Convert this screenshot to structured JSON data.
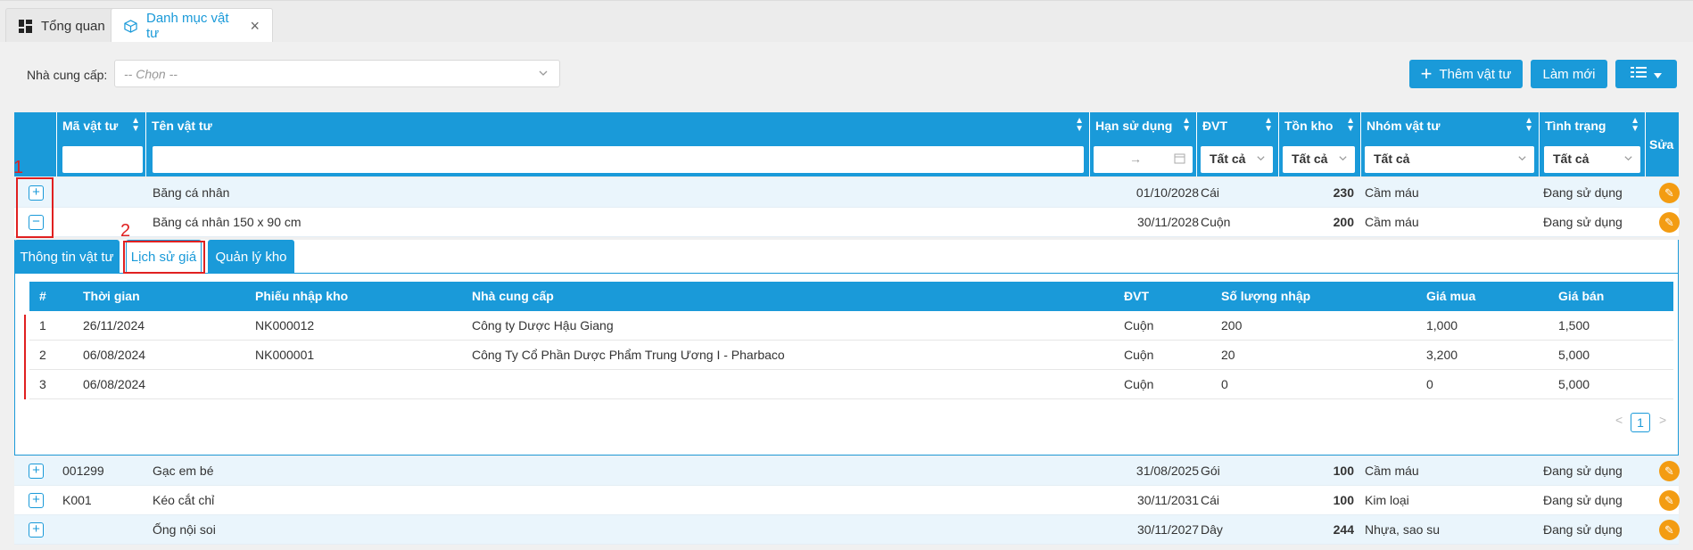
{
  "tabs": [
    {
      "label": "Tổng quan",
      "icon": "dashboard-icon"
    },
    {
      "label": "Danh mục vật tư",
      "icon": "box-icon",
      "active": true
    }
  ],
  "filter": {
    "supplier_label": "Nhà cung cấp:",
    "supplier_placeholder": "-- Chọn --"
  },
  "toolbar": {
    "add_label": "Thêm vật tư",
    "refresh_label": "Làm mới"
  },
  "columns": {
    "code": "Mã vật tư",
    "name": "Tên vật tư",
    "expiry": "Hạn sử dụng",
    "unit": "ĐVT",
    "stock": "Tồn kho",
    "group": "Nhóm vật tư",
    "status": "Tình trạng",
    "edit": "Sửa"
  },
  "column_filters": {
    "date_arrow": "→",
    "unit": "Tất cả",
    "stock": "Tất cả",
    "group": "Tất cả",
    "status": "Tất cả"
  },
  "rows": [
    {
      "code": "",
      "name": "Băng cá nhân",
      "expiry": "01/10/2028",
      "unit": "Cái",
      "stock": "230",
      "group": "Cầm máu",
      "status": "Đang sử dụng",
      "expanded": false
    },
    {
      "code": "",
      "name": "Băng cá nhân 150 x 90 cm",
      "expiry": "30/11/2028",
      "unit": "Cuộn",
      "stock": "200",
      "group": "Cầm máu",
      "status": "Đang sử dụng",
      "expanded": true
    },
    {
      "code": "001299",
      "name": "Gạc em bé",
      "expiry": "31/08/2025",
      "unit": "Gói",
      "stock": "100",
      "group": "Cầm máu",
      "status": "Đang sử dụng",
      "expanded": false
    },
    {
      "code": "K001",
      "name": "Kéo cắt chỉ",
      "expiry": "30/11/2031",
      "unit": "Cái",
      "stock": "100",
      "group": "Kim loại",
      "status": "Đang sử dụng",
      "expanded": false
    },
    {
      "code": "",
      "name": "Ống nội soi",
      "expiry": "30/11/2027",
      "unit": "Dây",
      "stock": "244",
      "group": "Nhựa, sao su",
      "status": "Đang sử dụng",
      "expanded": false
    }
  ],
  "detail": {
    "tabs": [
      "Thông tin vật tư",
      "Lịch sử giá",
      "Quản lý kho"
    ],
    "active_tab": "Lịch sử giá",
    "columns": {
      "index": "#",
      "time": "Thời gian",
      "receipt": "Phiếu nhập kho",
      "supplier": "Nhà cung cấp",
      "unit": "ĐVT",
      "qty": "Số lượng nhập",
      "buy": "Giá mua",
      "sell": "Giá bán"
    },
    "rows": [
      {
        "index": "1",
        "time": "26/11/2024",
        "receipt": "NK000012",
        "supplier": "Công ty Dược Hậu Giang",
        "unit": "Cuộn",
        "qty": "200",
        "buy": "1,000",
        "sell": "1,500"
      },
      {
        "index": "2",
        "time": "06/08/2024",
        "receipt": "NK000001",
        "supplier": "Công Ty Cổ Phần Dược Phẩm Trung Ương I - Pharbaco",
        "unit": "Cuộn",
        "qty": "20",
        "buy": "3,200",
        "sell": "5,000"
      },
      {
        "index": "3",
        "time": "06/08/2024",
        "receipt": "",
        "supplier": "",
        "unit": "Cuộn",
        "qty": "0",
        "buy": "0",
        "sell": "5,000"
      }
    ],
    "pager": {
      "prev": "<",
      "current": "1",
      "next": ">"
    }
  },
  "annotations": {
    "label1": "1",
    "label2": "2"
  },
  "colors": {
    "primary": "#1a9ad9",
    "edit": "#f39c12",
    "annotation": "#e02020"
  }
}
